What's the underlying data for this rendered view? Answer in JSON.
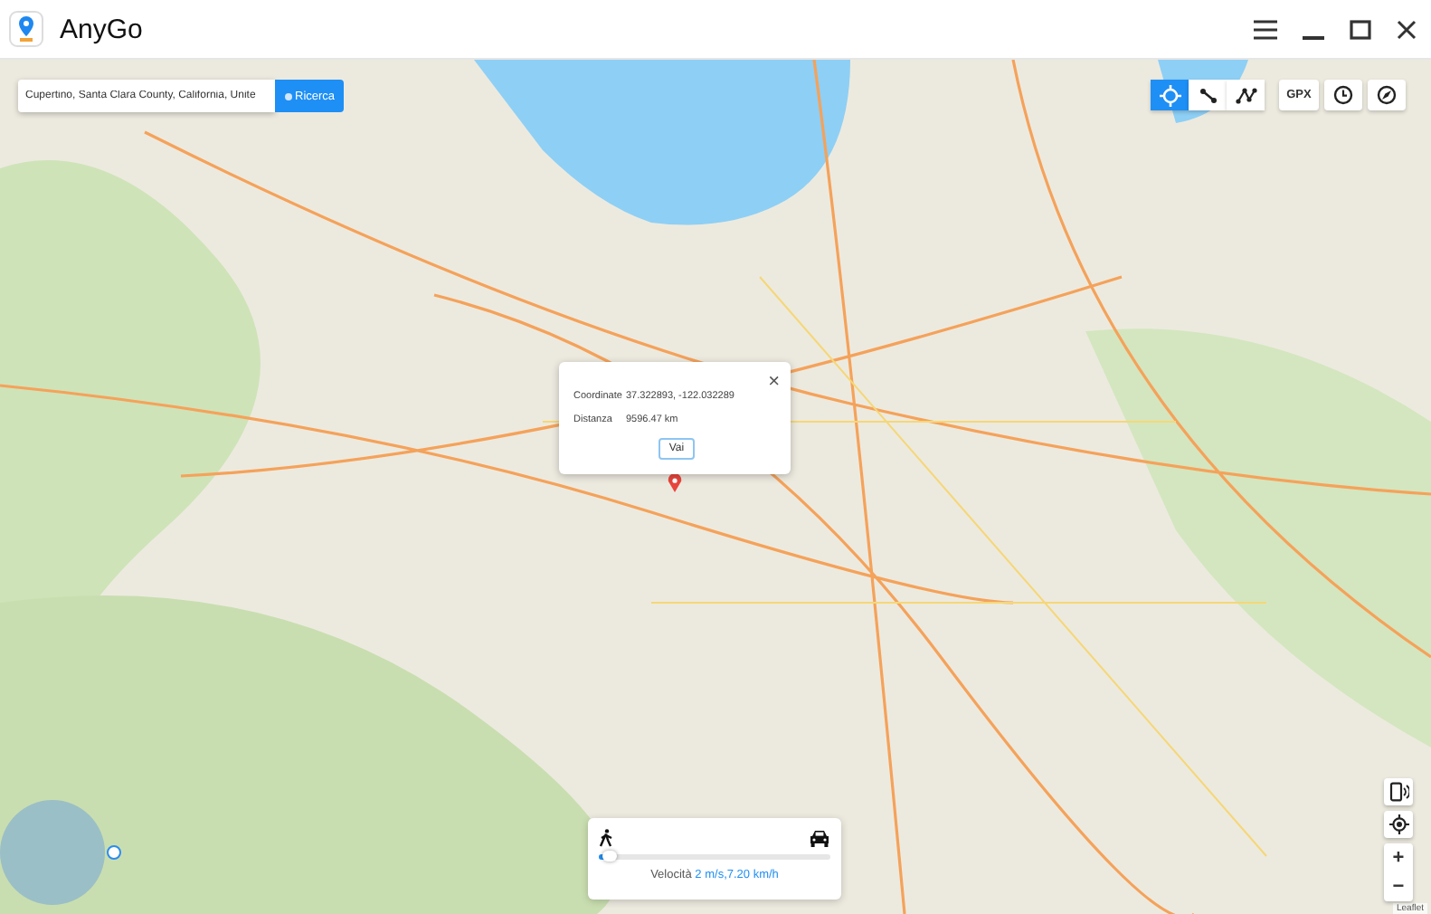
{
  "window": {
    "title": "AnyGo"
  },
  "search": {
    "value": "Cupertino, Santa Clara County, California, Unite",
    "button": "Ricerca"
  },
  "modes": [
    {
      "kind": "teleport",
      "selected": true
    },
    {
      "kind": "two-spot",
      "selected": false
    },
    {
      "kind": "multi-spot",
      "selected": false
    }
  ],
  "tools": [
    {
      "kind": "gpx",
      "label": "GPX"
    },
    {
      "kind": "history"
    },
    {
      "kind": "compass"
    }
  ],
  "popup": {
    "close": "×",
    "rows": [
      {
        "label": "Coordinate",
        "value": "37.322893, -122.032289"
      },
      {
        "label": "Distanza",
        "value": "9596.47 km"
      }
    ],
    "button": "Vai"
  },
  "speed_panel": {
    "level": 0.03,
    "label": "Velocità",
    "value": "2 m/s,7.20 km/h"
  },
  "map_controls": {
    "zoom_in": "+",
    "zoom_out": "−"
  },
  "attribution": "Leaflet"
}
